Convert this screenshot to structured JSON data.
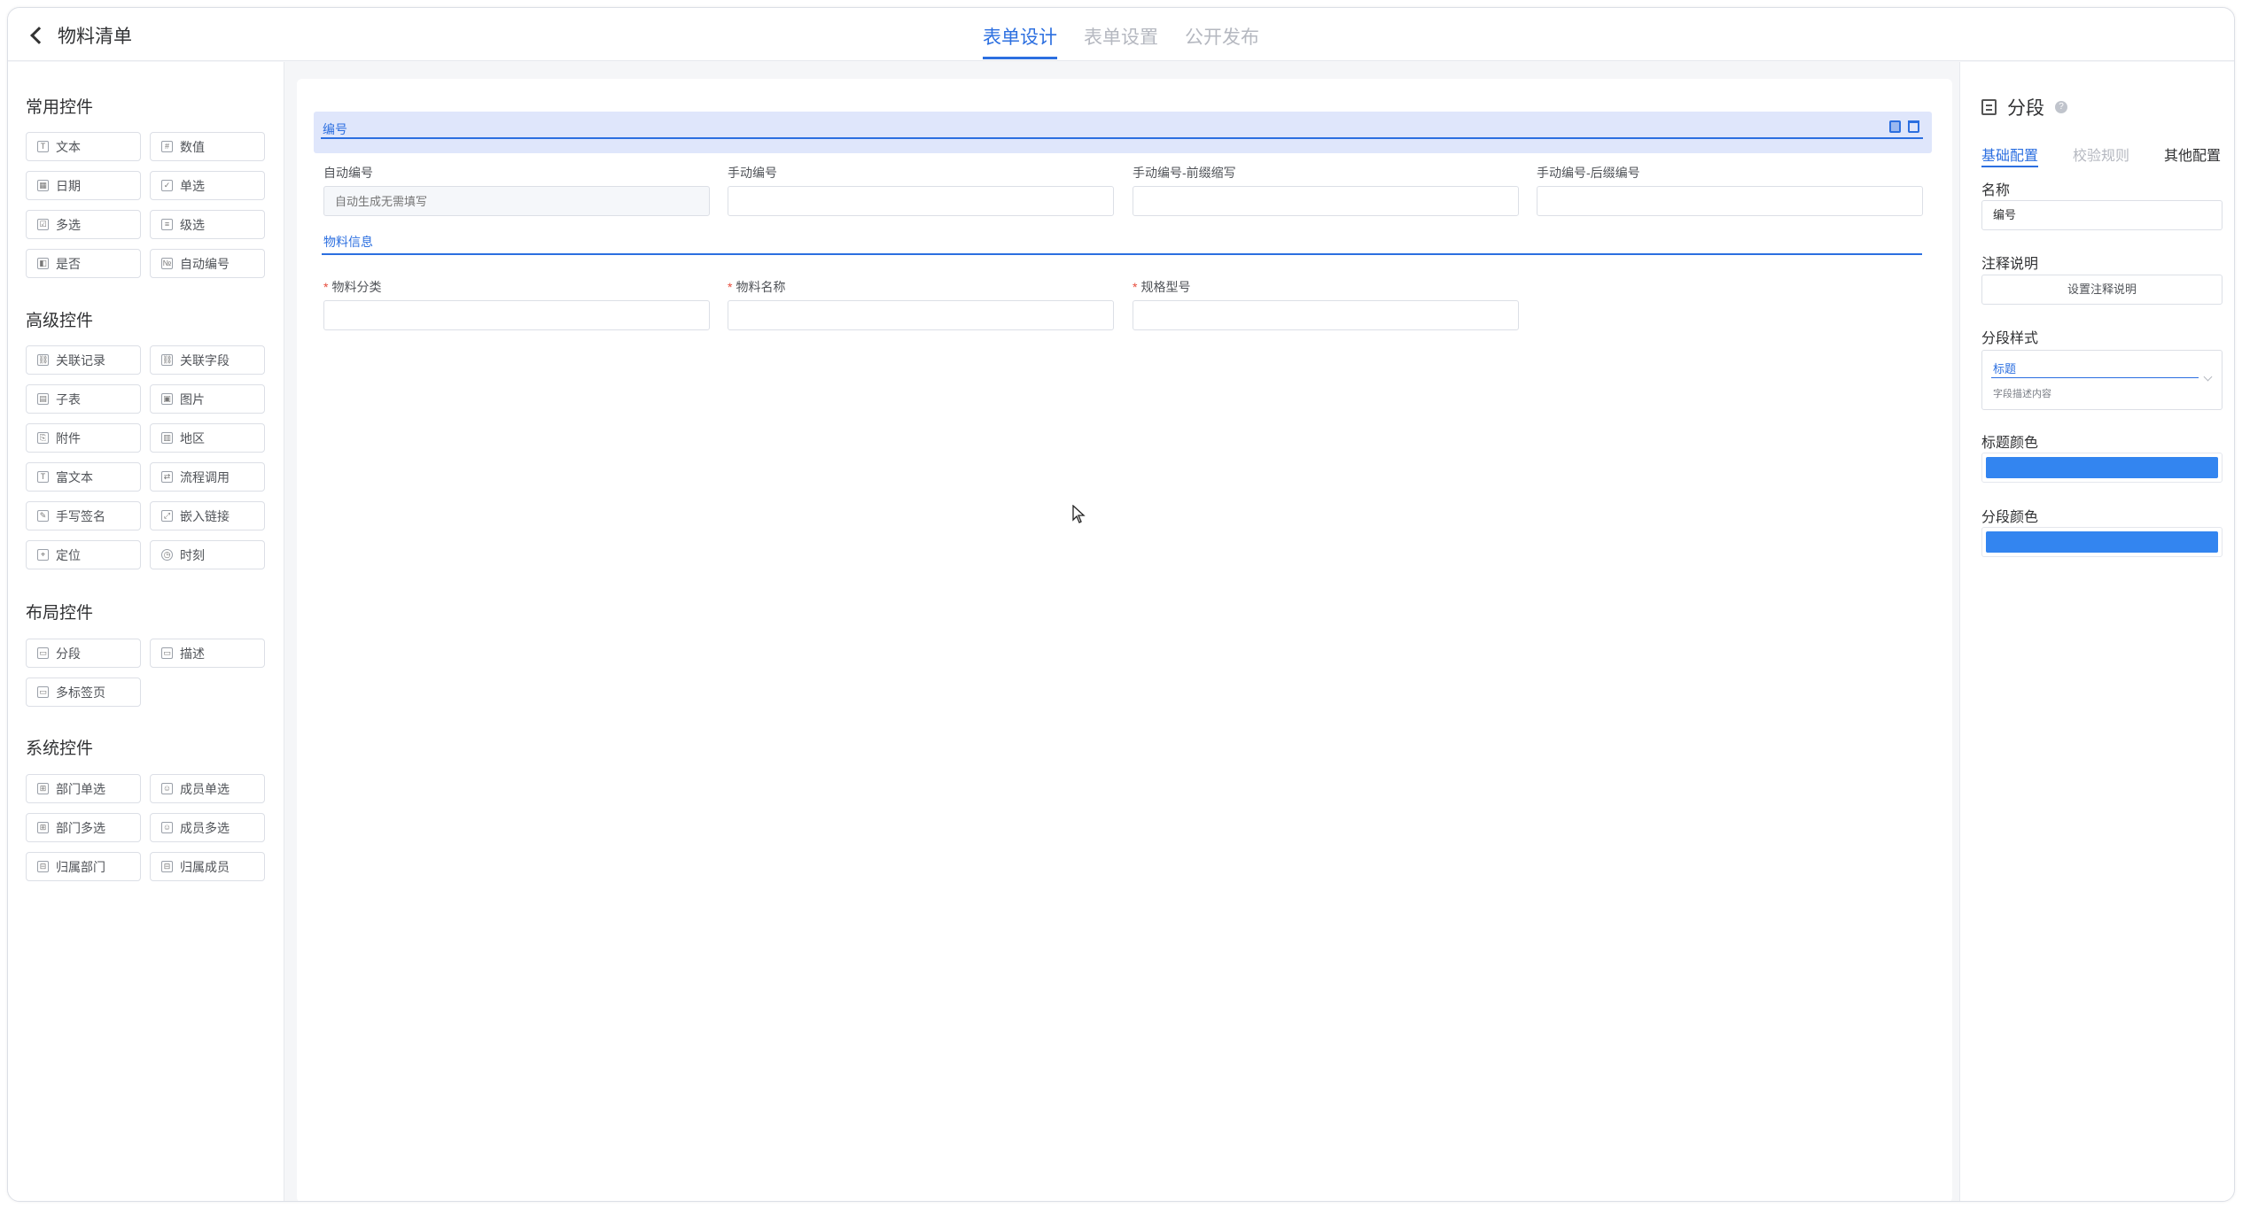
{
  "header": {
    "back_title": "物料清单",
    "tabs": [
      {
        "label": "表单设计",
        "active": true
      },
      {
        "label": "表单设置",
        "active": false
      },
      {
        "label": "公开发布",
        "active": false
      }
    ]
  },
  "palette": {
    "common": {
      "title": "常用控件",
      "items": [
        "文本",
        "数值",
        "日期",
        "单选",
        "多选",
        "级选",
        "是否",
        "自动编号"
      ]
    },
    "advanced": {
      "title": "高级控件",
      "items": [
        "关联记录",
        "关联字段",
        "子表",
        "图片",
        "附件",
        "地区",
        "富文本",
        "流程调用",
        "手写签名",
        "嵌入链接",
        "定位",
        "时刻"
      ]
    },
    "layout": {
      "title": "布局控件",
      "items": [
        "分段",
        "描述",
        "多标签页"
      ]
    },
    "system": {
      "title": "系统控件",
      "items": [
        "部门单选",
        "成员单选",
        "部门多选",
        "成员多选",
        "归属部门",
        "归属成员"
      ]
    }
  },
  "canvas": {
    "section1": {
      "label": "编号",
      "fields": [
        {
          "label": "自动编号",
          "placeholder": "自动生成无需填写",
          "disabled": true
        },
        {
          "label": "手动编号",
          "placeholder": ""
        },
        {
          "label": "手动编号-前缀缩写",
          "placeholder": ""
        },
        {
          "label": "手动编号-后缀编号",
          "placeholder": ""
        }
      ]
    },
    "section2": {
      "label": "物料信息",
      "fields": [
        {
          "label": "物料分类",
          "required": true
        },
        {
          "label": "物料名称",
          "required": true
        },
        {
          "label": "规格型号",
          "required": true
        }
      ]
    }
  },
  "props": {
    "title": "分段",
    "help": "?",
    "tabs": [
      {
        "label": "基础配置",
        "active": true
      },
      {
        "label": "校验规则",
        "active": false
      },
      {
        "label": "其他配置",
        "active": false
      }
    ],
    "name_label": "名称",
    "name_value": "编号",
    "note_label": "注释说明",
    "note_button": "设置注释说明",
    "style_label": "分段样式",
    "style_title": "标题",
    "style_desc": "字段描述内容",
    "title_color_label": "标题颜色",
    "title_color": "#3385f0",
    "seg_color_label": "分段颜色",
    "seg_color": "#3385f0"
  },
  "colors": {
    "accent": "#2c6fe0",
    "section_bg": "#dfe6fb"
  }
}
